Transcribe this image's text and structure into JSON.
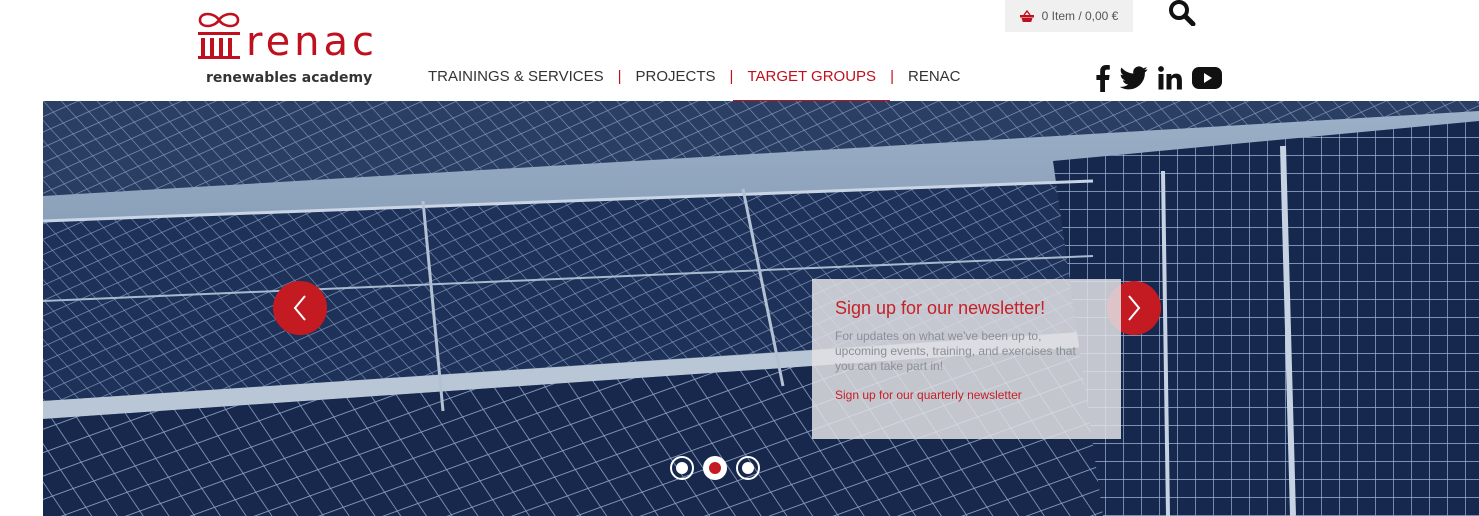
{
  "brand": {
    "name": "renac",
    "tagline": "renewables academy",
    "accent_color": "#c00f1e",
    "logo_icon": "column-infinity-logo"
  },
  "header": {
    "cart": {
      "icon": "basket-icon",
      "label": "0 Item / 0,00 €"
    },
    "search_icon": "search-icon",
    "nav": [
      {
        "label": "TRAININGS & SERVICES",
        "active": false
      },
      {
        "label": "PROJECTS",
        "active": false
      },
      {
        "label": "TARGET GROUPS",
        "active": true
      },
      {
        "label": "RENAC",
        "active": false
      }
    ],
    "social": [
      "facebook-icon",
      "twitter-icon",
      "linkedin-icon",
      "youtube-icon"
    ]
  },
  "slider": {
    "prev_icon": "chevron-left-icon",
    "next_icon": "chevron-right-icon",
    "newsletter": {
      "title": "Sign up for our newsletter!",
      "text": "For updates on what we've been up to, upcoming events, training, and exercises that you can take part in!",
      "link": "Sign up for our quarterly newsletter"
    },
    "dots": {
      "count": 3,
      "active_index": 1
    }
  }
}
